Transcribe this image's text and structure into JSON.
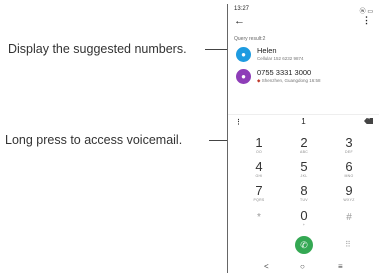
{
  "callouts": {
    "suggested": "Display the suggested numbers.",
    "voicemail": "Long press to access voicemail."
  },
  "status_bar": {
    "time": "13:27",
    "icons": "ⓦ ▭"
  },
  "app_bar": {
    "back_icon": "←",
    "more_icon": "⋮"
  },
  "query_result": "Query result:2",
  "contacts": [
    {
      "avatar_glyph": "●",
      "avatar_color": "#1e9be0",
      "name": "Helen",
      "detail": "Cellular 152 6232 9874"
    },
    {
      "avatar_glyph": "●",
      "avatar_color": "#8e3db8",
      "name": "0755 3331 3000",
      "detail": "Shenzhen, Guangdong 16:58"
    }
  ],
  "entry": {
    "menu_icon": "⋮",
    "number": "1",
    "backspace_glyph": "×"
  },
  "keypad": [
    {
      "digit": "1",
      "letters": "OO"
    },
    {
      "digit": "2",
      "letters": "ABC"
    },
    {
      "digit": "3",
      "letters": "DEF"
    },
    {
      "digit": "4",
      "letters": "GHI"
    },
    {
      "digit": "5",
      "letters": "JKL"
    },
    {
      "digit": "6",
      "letters": "MNO"
    },
    {
      "digit": "7",
      "letters": "PQRS"
    },
    {
      "digit": "8",
      "letters": "TUV"
    },
    {
      "digit": "9",
      "letters": "WXYZ"
    },
    {
      "symbol": "*"
    },
    {
      "digit": "0",
      "letters": "+"
    },
    {
      "symbol": "#"
    }
  ],
  "call_button_icon": "✆",
  "dialpad_icon": "⠿",
  "nav_bar": {
    "back": "<",
    "home": "○",
    "recents": "≡"
  }
}
